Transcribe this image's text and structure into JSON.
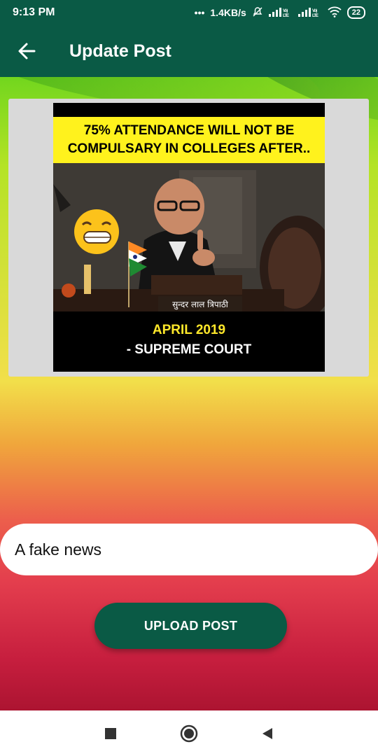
{
  "status": {
    "time": "9:13 PM",
    "dots": "•••",
    "speed": "1.4KB/s",
    "battery": "22"
  },
  "appbar": {
    "title": "Update Post"
  },
  "post_image": {
    "headline": "75% ATTENDANCE WILL NOT BE COMPULSARY IN COLLEGES AFTER..",
    "nameplate": "सुन्दर लाल त्रिपाठी",
    "date_text": "APRIL 2019",
    "source_text": "- SUPREME COURT"
  },
  "form": {
    "caption_value": "A fake news",
    "upload_label": "UPLOAD POST"
  },
  "colors": {
    "primary": "#0a5a45",
    "poster_yellow": "#fff21d"
  }
}
